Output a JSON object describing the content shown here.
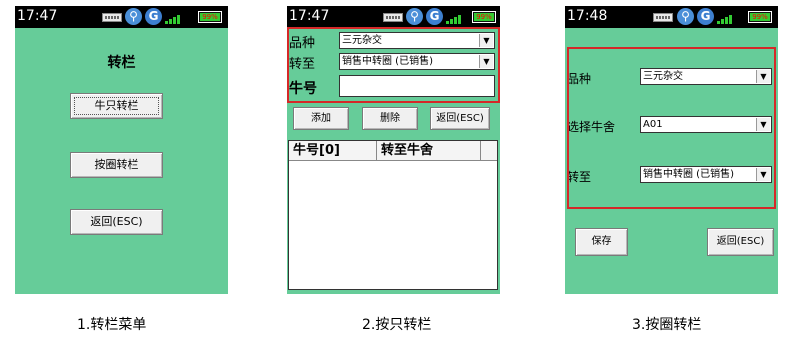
{
  "colors": {
    "screen_bg": "#66cc99",
    "highlight_border": "#d62828",
    "status_bar": "#000000"
  },
  "screens": [
    {
      "status": {
        "time": "17:47",
        "battery_label": "99%",
        "icons": [
          "keyboard-icon",
          "usb-icon",
          "g-network-icon",
          "signal-icon",
          "battery-icon"
        ]
      },
      "title": "转栏",
      "buttons": [
        "牛只转栏",
        "按圈转栏",
        "返回(ESC)"
      ],
      "caption": "1.转栏菜单"
    },
    {
      "status": {
        "time": "17:47",
        "battery_label": "99%",
        "icons": [
          "keyboard-icon",
          "usb-icon",
          "g-network-icon",
          "signal-icon",
          "battery-icon"
        ]
      },
      "breed_label": "品种",
      "breed_value": "三元杂交",
      "target_label": "转至",
      "target_value": "销售中转圈 (已销售)",
      "cattle_no_label": "牛号",
      "cattle_no_value": "",
      "buttons": {
        "add": "添加",
        "delete": "删除",
        "back": "返回(ESC)"
      },
      "list_columns": [
        "牛号[0]",
        "转至牛舍"
      ],
      "caption": "2.按只转栏"
    },
    {
      "status": {
        "time": "17:48",
        "battery_label": "99%",
        "icons": [
          "keyboard-icon",
          "usb-icon",
          "g-network-icon",
          "signal-icon",
          "battery-icon"
        ]
      },
      "breed_label": "品种",
      "breed_value": "三元杂交",
      "barn_label": "选择牛舍",
      "barn_value": "A01",
      "target_label": "转至",
      "target_value": "销售中转圈 (已销售)",
      "buttons": {
        "save": "保存",
        "back": "返回(ESC)"
      },
      "caption": "3.按圈转栏"
    }
  ]
}
